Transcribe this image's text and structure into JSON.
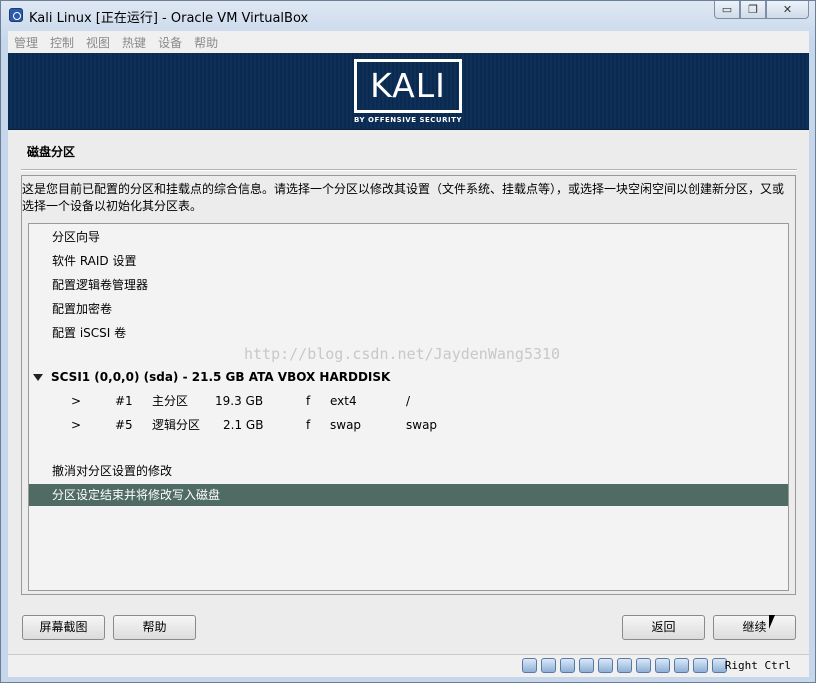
{
  "window": {
    "title": "Kali Linux [正在运行] - Oracle VM VirtualBox",
    "controls": {
      "minimize": "▭",
      "restore": "❐",
      "close": "✕"
    }
  },
  "menu": [
    "管理",
    "控制",
    "视图",
    "热键",
    "设备",
    "帮助"
  ],
  "banner": {
    "logo": "KALI",
    "tagline": "BY OFFENSIVE SECURITY"
  },
  "installer": {
    "section_title": "磁盘分区",
    "description": "这是您目前已配置的分区和挂载点的综合信息。请选择一个分区以修改其设置（文件系统、挂载点等），或选择一块空闲空间以创建新分区，又或选择一个设备以初始化其分区表。",
    "menu_items": [
      "分区向导",
      "软件 RAID 设置",
      "配置逻辑卷管理器",
      "配置加密卷",
      "配置 iSCSI 卷"
    ],
    "disk": {
      "label": "SCSI1 (0,0,0) (sda) - 21.5 GB ATA VBOX HARDDISK",
      "partitions": [
        {
          "arrow": ">",
          "num": "#1",
          "type": "主分区",
          "size": "19.3 GB",
          "flag": "f",
          "fs": "ext4",
          "mount": "/"
        },
        {
          "arrow": ">",
          "num": "#5",
          "type": "逻辑分区",
          "size": "2.1 GB",
          "flag": "f",
          "fs": "swap",
          "mount": "swap"
        }
      ]
    },
    "undo": "撤消对分区设置的修改",
    "finish": "分区设定结束并将修改写入磁盘",
    "watermark": "http://blog.csdn.net/JaydenWang5310",
    "buttons": {
      "screenshot": "屏幕截图",
      "help": "帮助",
      "back": "返回",
      "continue": "继续"
    }
  },
  "statusbar": {
    "host_key": "Right Ctrl"
  },
  "colors": {
    "selection": "#4f6b63",
    "banner": "#0d2f58"
  }
}
